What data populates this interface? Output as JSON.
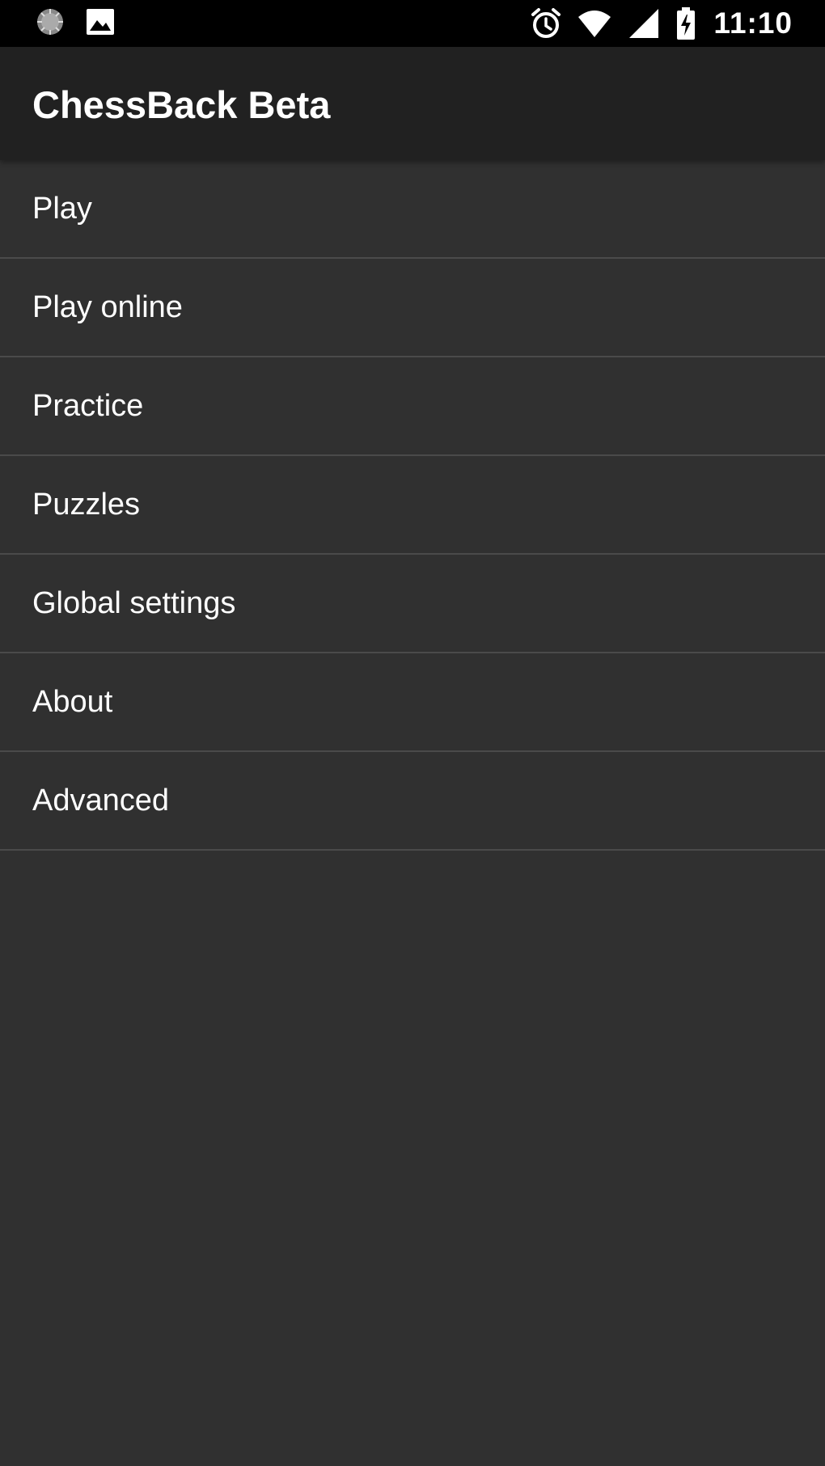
{
  "status_bar": {
    "time": "11:10",
    "left_icons": [
      "loading-spinner-icon",
      "image-icon"
    ],
    "right_icons": [
      "alarm-icon",
      "wifi-icon",
      "cell-signal-icon",
      "battery-charging-icon"
    ]
  },
  "app_bar": {
    "title": "ChessBack Beta"
  },
  "menu": {
    "items": [
      {
        "label": "Play"
      },
      {
        "label": "Play online"
      },
      {
        "label": "Practice"
      },
      {
        "label": "Puzzles"
      },
      {
        "label": "Global settings"
      },
      {
        "label": "About"
      },
      {
        "label": "Advanced"
      }
    ]
  },
  "colors": {
    "background": "#303030",
    "app_bar": "#212121",
    "status_bar": "#000000",
    "divider": "#4a4a4a",
    "text": "#ffffff"
  }
}
